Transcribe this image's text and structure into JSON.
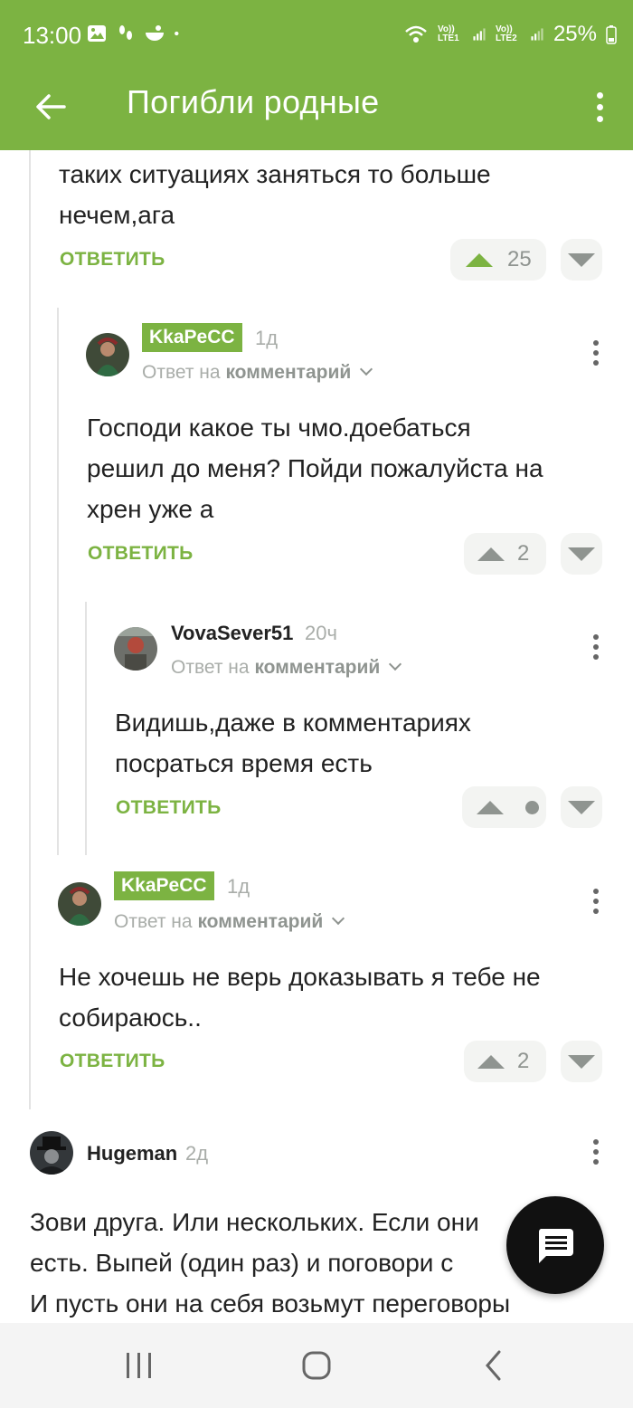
{
  "status_bar": {
    "time": "13:00",
    "battery": "25%",
    "net1": "Vo)) LTE1",
    "net2": "Vo)) LTE2"
  },
  "app_bar": {
    "title": "Погибли родные"
  },
  "reply_label": "ОТВЕТИТЬ",
  "reply_to_prefix": "Ответ на",
  "reply_to_target": "комментарий",
  "comments": [
    {
      "text_lines": [
        "таких ситуациях заняться то больше",
        "нечем,ага"
      ],
      "score": "25"
    },
    {
      "author": "KkaPeCC",
      "age": "1д",
      "text_lines": [
        "Господи какое ты чмо.доебаться",
        "решил до меня? Пойди пожалуйста на",
        "хрен уже а"
      ],
      "score": "2"
    },
    {
      "author": "VovaSever51",
      "age": "20ч",
      "text_lines": [
        "Видишь,даже в комментариях",
        "посраться время есть"
      ],
      "score": ""
    },
    {
      "author": "KkaPeCC",
      "age": "1д",
      "text_lines": [
        "Не хочешь не верь доказывать я тебе не",
        "собираюсь.."
      ],
      "score": "2"
    },
    {
      "author": "Hugeman",
      "age": "2д",
      "text_lines": [
        "Зови друга. Или нескольких. Если они",
        "есть. Выпей (один раз) и поговори с",
        "И пусть они на себя возьмут переговоры"
      ]
    }
  ],
  "colors": {
    "accent": "#7cb342",
    "text": "#222222",
    "muted": "#8f9490"
  }
}
